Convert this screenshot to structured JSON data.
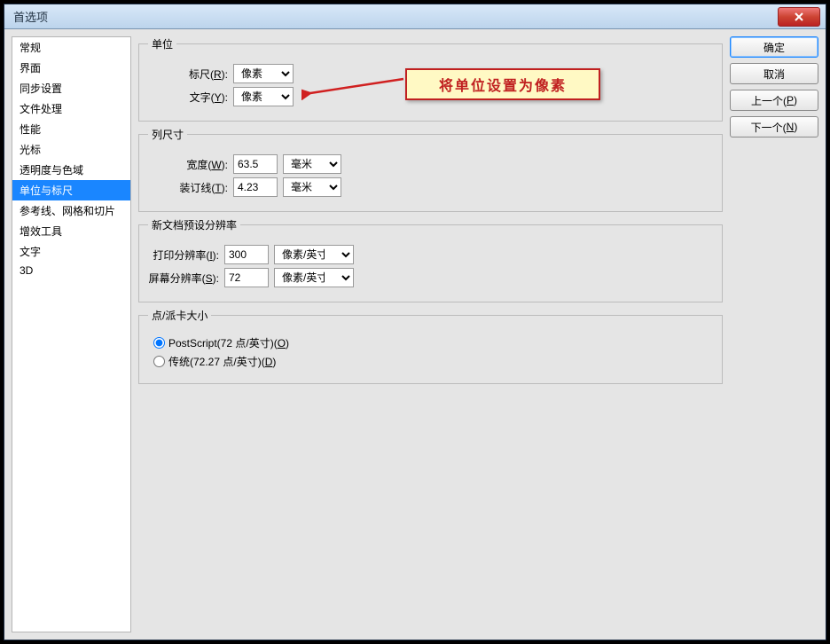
{
  "window": {
    "title": "首选项"
  },
  "sidebar": {
    "items": [
      "常规",
      "界面",
      "同步设置",
      "文件处理",
      "性能",
      "光标",
      "透明度与色域",
      "单位与标尺",
      "参考线、网格和切片",
      "增效工具",
      "文字",
      "3D"
    ],
    "selectedIndex": 7
  },
  "groups": {
    "units": {
      "legend": "单位",
      "ruler_label_pre": "标尺(",
      "ruler_label_key": "R",
      "ruler_label_post": "):",
      "ruler_value": "像素",
      "type_label_pre": "文字(",
      "type_label_key": "Y",
      "type_label_post": "):",
      "type_value": "像素"
    },
    "columns": {
      "legend": "列尺寸",
      "width_label_pre": "宽度(",
      "width_label_key": "W",
      "width_label_post": "):",
      "width_value": "63.5",
      "width_unit": "毫米",
      "gutter_label_pre": "装订线(",
      "gutter_label_key": "T",
      "gutter_label_post": "):",
      "gutter_value": "4.23",
      "gutter_unit": "毫米"
    },
    "newdoc": {
      "legend": "新文档预设分辨率",
      "print_label_pre": "打印分辨率(",
      "print_label_key": "I",
      "print_label_post": "):",
      "print_value": "300",
      "print_unit": "像素/英寸",
      "screen_label_pre": "屏幕分辨率(",
      "screen_label_key": "S",
      "screen_label_post": "):",
      "screen_value": "72",
      "screen_unit": "像素/英寸"
    },
    "pica": {
      "legend": "点/派卡大小",
      "opt1_pre": "PostScript(72 点/英寸)(",
      "opt1_key": "O",
      "opt1_post": ")",
      "opt2_pre": "传统(72.27 点/英寸)(",
      "opt2_key": "D",
      "opt2_post": ")"
    }
  },
  "buttons": {
    "ok": "确定",
    "cancel": "取消",
    "prev_pre": "上一个(",
    "prev_key": "P",
    "prev_post": ")",
    "next_pre": "下一个(",
    "next_key": "N",
    "next_post": ")"
  },
  "annotation": {
    "text": "将单位设置为像素"
  }
}
